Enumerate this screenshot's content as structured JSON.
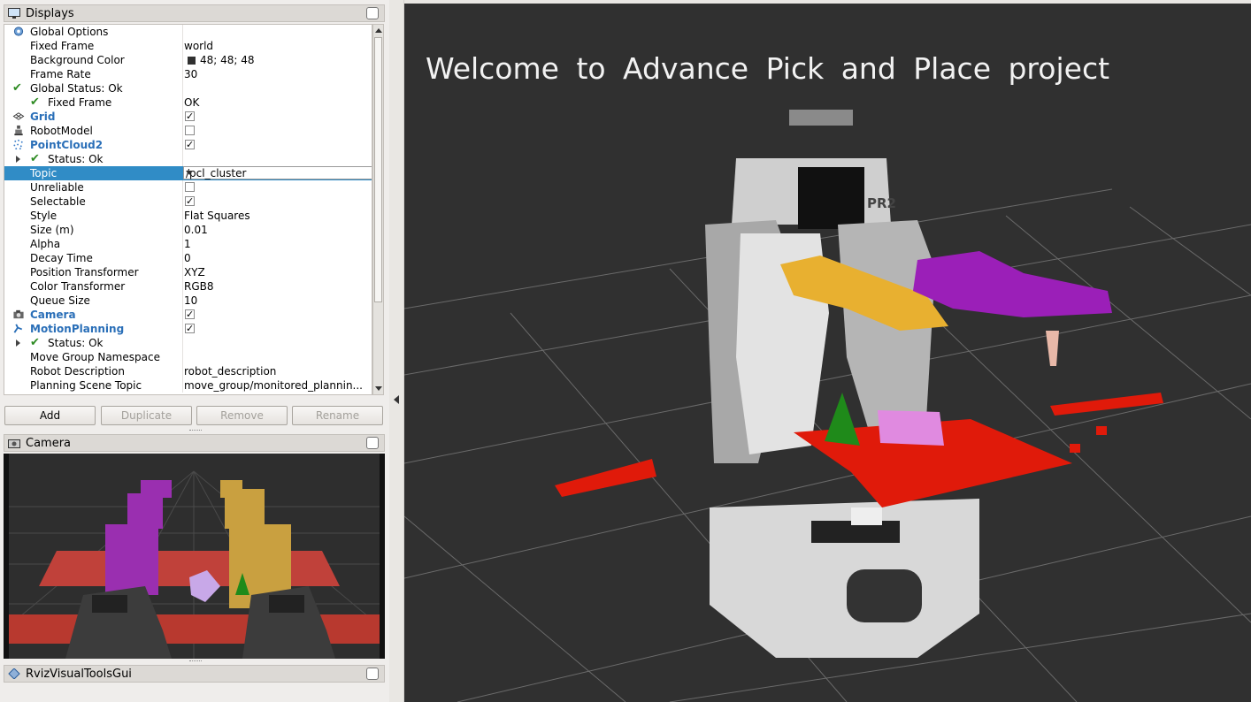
{
  "displays_panel": {
    "title": "Displays",
    "rows": [
      {
        "label": "Global Options",
        "value": ""
      },
      {
        "label": "Fixed Frame",
        "value": "world"
      },
      {
        "label": "Background Color",
        "value": "48; 48; 48"
      },
      {
        "label": "Frame Rate",
        "value": "30"
      },
      {
        "label": "Global Status: Ok",
        "value": ""
      },
      {
        "label": "Fixed Frame",
        "value": "OK"
      },
      {
        "label": "Grid",
        "value": ""
      },
      {
        "label": "RobotModel",
        "value": ""
      },
      {
        "label": "PointCloud2",
        "value": ""
      },
      {
        "label": "Status: Ok",
        "value": ""
      },
      {
        "label": "Topic",
        "value": "/pcl_cluster"
      },
      {
        "label": "Unreliable",
        "value": ""
      },
      {
        "label": "Selectable",
        "value": ""
      },
      {
        "label": "Style",
        "value": "Flat Squares"
      },
      {
        "label": "Size (m)",
        "value": "0.01"
      },
      {
        "label": "Alpha",
        "value": "1"
      },
      {
        "label": "Decay Time",
        "value": "0"
      },
      {
        "label": "Position Transformer",
        "value": "XYZ"
      },
      {
        "label": "Color Transformer",
        "value": "RGB8"
      },
      {
        "label": "Queue Size",
        "value": "10"
      },
      {
        "label": "Camera",
        "value": ""
      },
      {
        "label": "MotionPlanning",
        "value": ""
      },
      {
        "label": "Status: Ok",
        "value": ""
      },
      {
        "label": "Move Group Namespace",
        "value": ""
      },
      {
        "label": "Robot Description",
        "value": "robot_description"
      },
      {
        "label": "Planning Scene Topic",
        "value": "move_group/monitored_plannin..."
      }
    ],
    "checkboxes": {
      "grid": true,
      "robot_model": false,
      "pointcloud2": true,
      "unreliable": false,
      "selectable": true,
      "camera": true,
      "motion_planning": true
    },
    "background_swatch": "#303030",
    "buttons": {
      "add": "Add",
      "duplicate": "Duplicate",
      "remove": "Remove",
      "rename": "Rename"
    }
  },
  "camera_panel": {
    "title": "Camera"
  },
  "rviz_tools_panel": {
    "title": "RvizVisualToolsGui"
  },
  "viewport": {
    "overlay_text": "Welcome to Advance Pick and Place project",
    "robot_label": "PR2",
    "background": "#303030"
  },
  "colors": {
    "selection": "#308cc6",
    "display_name": "#2a6fb8",
    "status_ok": "#2e8b23",
    "cluster_red": "#e01a0a",
    "cluster_purple": "#9b1fb8",
    "cluster_yellow": "#e8b030",
    "cluster_green": "#1f8a1a",
    "cluster_pink": "#e08ae0"
  },
  "icons": [
    "monitor-icon",
    "gear-icon",
    "check-icon",
    "grid-icon",
    "robot-icon",
    "pointcloud-icon",
    "camera-icon",
    "motion-planning-icon",
    "expand-arrow-icon",
    "dropdown-arrow-icon",
    "collapse-left-icon",
    "diamond-icon"
  ]
}
